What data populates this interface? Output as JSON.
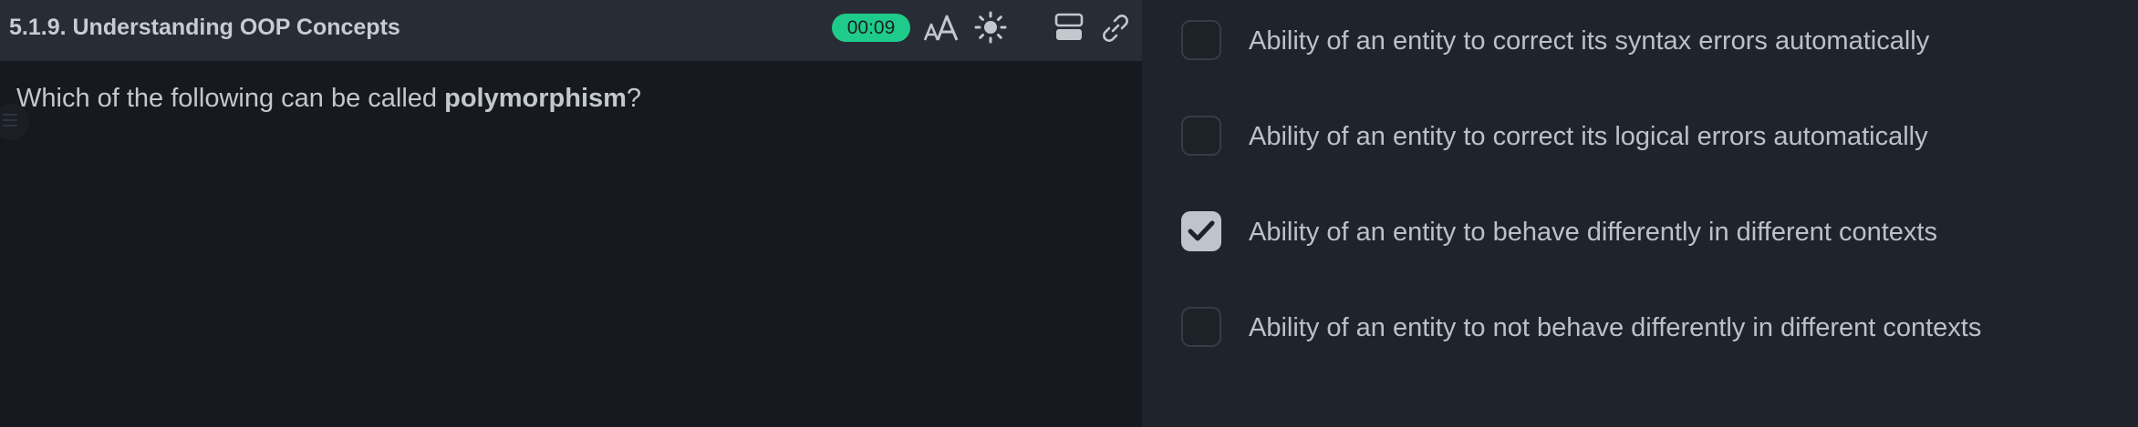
{
  "header": {
    "title": "5.1.9. Understanding OOP Concepts",
    "timer": "00:09",
    "icons": [
      "font-size-icon",
      "theme-sun-icon",
      "layout-split-icon",
      "link-icon"
    ]
  },
  "question": {
    "prefix": "Which of the following can be called ",
    "emphasis": "polymorphism",
    "suffix": "?"
  },
  "options": [
    {
      "label": "Ability of an entity to correct its syntax errors automatically",
      "checked": false
    },
    {
      "label": "Ability of an entity to correct its logical errors automatically",
      "checked": false
    },
    {
      "label": "Ability of an entity to behave differently in different contexts",
      "checked": true
    },
    {
      "label": "Ability of an entity to not behave differently in different contexts",
      "checked": false
    }
  ],
  "colors": {
    "timer_bg": "#1fcb8a",
    "header_bg": "#282d35",
    "left_bg": "#16191e",
    "right_bg": "#1f242c",
    "checked_bg": "#bfc4cc"
  }
}
